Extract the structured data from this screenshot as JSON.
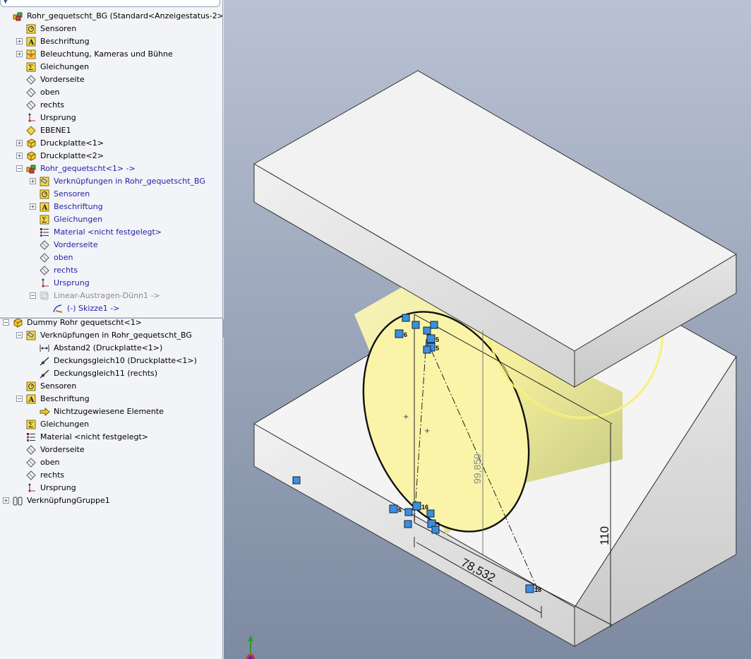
{
  "tree": {
    "rows": [
      {
        "label": "Rohr_gequetscht_BG  (Standard<Anzeigestatus-2>)",
        "level": 0,
        "expander": "",
        "icon": "assembly-icon",
        "style": "normal"
      },
      {
        "label": "Sensoren",
        "level": 1,
        "expander": "",
        "icon": "sensor-icon",
        "style": "normal"
      },
      {
        "label": "Beschriftung",
        "level": 1,
        "expander": "+",
        "icon": "annotation-icon",
        "style": "normal"
      },
      {
        "label": "Beleuchtung, Kameras und Bühne",
        "level": 1,
        "expander": "+",
        "icon": "lights-icon",
        "style": "normal"
      },
      {
        "label": "Gleichungen",
        "level": 1,
        "expander": "",
        "icon": "equations-icon",
        "style": "normal"
      },
      {
        "label": "Vorderseite",
        "level": 1,
        "expander": "",
        "icon": "plane-icon",
        "style": "normal"
      },
      {
        "label": "oben",
        "level": 1,
        "expander": "",
        "icon": "plane-icon",
        "style": "normal"
      },
      {
        "label": "rechts",
        "level": 1,
        "expander": "",
        "icon": "plane-icon",
        "style": "normal"
      },
      {
        "label": "Ursprung",
        "level": 1,
        "expander": "",
        "icon": "origin-icon",
        "style": "normal"
      },
      {
        "label": "EBENE1",
        "level": 1,
        "expander": "",
        "icon": "plane-yellow-icon",
        "style": "normal"
      },
      {
        "label": "Druckplatte<1>",
        "level": 1,
        "expander": "+",
        "icon": "part-icon",
        "style": "normal"
      },
      {
        "label": "Druckplatte<2>",
        "level": 1,
        "expander": "+",
        "icon": "part-icon",
        "style": "normal"
      },
      {
        "label": "Rohr_gequetscht<1> ->",
        "level": 1,
        "expander": "−",
        "icon": "subassembly-icon",
        "style": "blue"
      },
      {
        "label": "Verknüpfungen in Rohr_gequetscht_BG",
        "level": 2,
        "expander": "+",
        "icon": "mates-icon",
        "style": "blue"
      },
      {
        "label": "Sensoren",
        "level": 2,
        "expander": "",
        "icon": "sensor-icon",
        "style": "blue"
      },
      {
        "label": "Beschriftung",
        "level": 2,
        "expander": "+",
        "icon": "annotation-icon",
        "style": "blue"
      },
      {
        "label": "Gleichungen",
        "level": 2,
        "expander": "",
        "icon": "equations-icon",
        "style": "blue"
      },
      {
        "label": "Material <nicht festgelegt>",
        "level": 2,
        "expander": "",
        "icon": "material-icon",
        "style": "blue"
      },
      {
        "label": "Vorderseite",
        "level": 2,
        "expander": "",
        "icon": "plane-icon",
        "style": "blue"
      },
      {
        "label": "oben",
        "level": 2,
        "expander": "",
        "icon": "plane-icon",
        "style": "blue"
      },
      {
        "label": "rechts",
        "level": 2,
        "expander": "",
        "icon": "plane-icon",
        "style": "blue"
      },
      {
        "label": "Ursprung",
        "level": 2,
        "expander": "",
        "icon": "origin-icon",
        "style": "blue"
      },
      {
        "label": "Linear-Austragen-Dünn1 ->",
        "level": 2,
        "expander": "−",
        "icon": "extrude-icon",
        "style": "grey"
      },
      {
        "label": "(-) Skizze1 ->",
        "level": 3,
        "expander": "",
        "icon": "sketch-icon",
        "style": "blue"
      },
      {
        "label": "Dummy Rohr gequetscht<1>",
        "level": 0,
        "expander": "−",
        "icon": "part-icon",
        "style": "normal"
      },
      {
        "label": "Verknüpfungen in Rohr_gequetscht_BG",
        "level": 1,
        "expander": "−",
        "icon": "mates-icon",
        "style": "normal"
      },
      {
        "label": "Abstand2 (Druckplatte<1>)",
        "level": 2,
        "expander": "",
        "icon": "distance-icon",
        "style": "normal"
      },
      {
        "label": "Deckungsgleich10 (Druckplatte<1>)",
        "level": 2,
        "expander": "",
        "icon": "coincident-icon",
        "style": "normal"
      },
      {
        "label": "Deckungsgleich11 (rechts)",
        "level": 2,
        "expander": "",
        "icon": "coincident-icon",
        "style": "normal"
      },
      {
        "label": "Sensoren",
        "level": 1,
        "expander": "",
        "icon": "sensor-icon",
        "style": "normal"
      },
      {
        "label": "Beschriftung",
        "level": 1,
        "expander": "−",
        "icon": "annotation-icon",
        "style": "normal"
      },
      {
        "label": "Nichtzugewiesene Elemente",
        "level": 2,
        "expander": "",
        "icon": "unassigned-icon",
        "style": "normal"
      },
      {
        "label": "Gleichungen",
        "level": 1,
        "expander": "",
        "icon": "equations-icon",
        "style": "normal"
      },
      {
        "label": "Material <nicht festgelegt>",
        "level": 1,
        "expander": "",
        "icon": "material-icon",
        "style": "normal"
      },
      {
        "label": "Vorderseite",
        "level": 1,
        "expander": "",
        "icon": "plane-icon",
        "style": "normal"
      },
      {
        "label": "oben",
        "level": 1,
        "expander": "",
        "icon": "plane-icon",
        "style": "normal"
      },
      {
        "label": "rechts",
        "level": 1,
        "expander": "",
        "icon": "plane-icon",
        "style": "normal"
      },
      {
        "label": "Ursprung",
        "level": 1,
        "expander": "",
        "icon": "origin-icon",
        "style": "normal"
      },
      {
        "label": "VerknüpfungGruppe1",
        "level": 0,
        "expander": "+",
        "icon": "mate-group-icon",
        "style": "normal"
      }
    ]
  },
  "viewport": {
    "dimensions": {
      "diagonal": "99,850",
      "width": "78,532",
      "height": "110"
    },
    "relation_badges": [
      "6",
      "5",
      "5",
      "6",
      "16",
      "5",
      "18"
    ],
    "colors": {
      "background_top": "#b9c2d3",
      "background_bottom": "#7d8aa1",
      "plate_top": "#f2f2f2",
      "plate_side": "#dcdcdc",
      "tube_highlight": "#f6f08a",
      "sketch_blue": "#3b8fe0"
    }
  }
}
